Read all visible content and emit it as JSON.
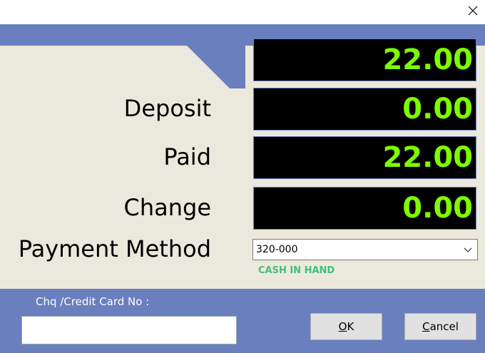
{
  "window": {
    "close_icon": "close-icon"
  },
  "amounts": {
    "total": "22.00",
    "deposit": "0.00",
    "paid": "22.00",
    "change": "0.00"
  },
  "labels": {
    "deposit": "Deposit",
    "paid": "Paid",
    "change": "Change",
    "payment_method": "Payment Method"
  },
  "payment_method": {
    "selected": "320-000",
    "description": "CASH IN HAND"
  },
  "cheque": {
    "label": "Chq /Credit Card No :",
    "value": ""
  },
  "buttons": {
    "ok_mnemonic": "O",
    "ok_rest": "K",
    "cancel_mnemonic": "C",
    "cancel_rest": "ancel"
  },
  "colors": {
    "band": "#6a7fbd",
    "panel": "#ebe9dc",
    "display_bg": "#000000",
    "display_text": "#7cfc00",
    "method_desc": "#3fbf7f"
  }
}
